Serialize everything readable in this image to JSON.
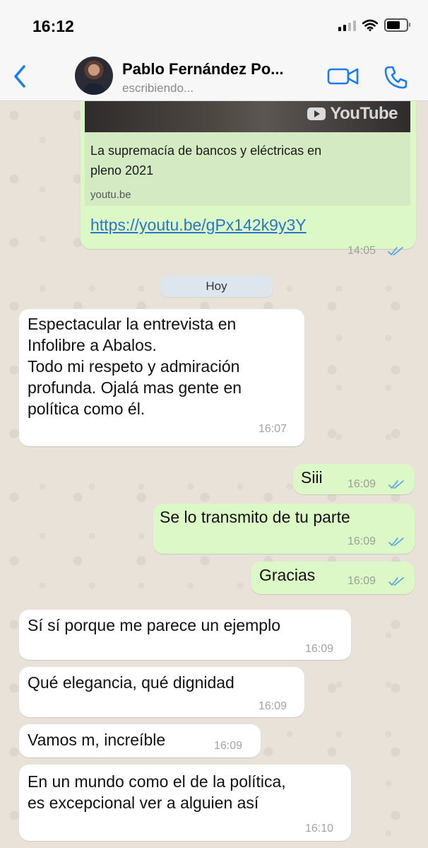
{
  "status_bar": {
    "time": "16:12"
  },
  "header": {
    "contact_name": "Pablo Fernández Po...",
    "status": "escribiendo..."
  },
  "link_message": {
    "thumbnail_brand": "YouTube",
    "preview_title": "La supremacía de bancos y eléctricas en\npleno 2021",
    "preview_domain": "youtu.be",
    "url": "https://youtu.be/gPx142k9y3Y",
    "time": "14:05"
  },
  "day_separator": "Hoy",
  "messages": [
    {
      "text": "Espectacular la entrevista en\nInfolibre a Abalos.\nTodo mi respeto y admiración\nprofunda. Ojalá mas gente en\npolítica como él.",
      "time": "16:07"
    },
    {
      "text": "Siii",
      "time": "16:09"
    },
    {
      "text": "Se lo transmito de tu parte",
      "time": "16:09"
    },
    {
      "text": "Gracias",
      "time": "16:09"
    },
    {
      "text": "Sí sí porque me parece un ejemplo",
      "time": "16:09"
    },
    {
      "text": "Qué elegancia, qué dignidad",
      "time": "16:09"
    },
    {
      "text": "Vamos m, increíble",
      "time": "16:09"
    },
    {
      "text": "En un mundo como el de la política,\nes excepcional ver a alguien así",
      "time": "16:10"
    }
  ],
  "colors": {
    "outgoing_bubble": "#dcf8c6",
    "incoming_bubble": "#ffffff",
    "accent": "#1a7cf0",
    "read_ticks": "#4fa3e0"
  },
  "icons": {
    "back": "chevron-left-icon",
    "video": "video-camera-icon",
    "call": "phone-icon",
    "wifi": "wifi-icon",
    "signal": "signal-icon",
    "battery": "battery-icon",
    "read": "double-check-icon"
  }
}
